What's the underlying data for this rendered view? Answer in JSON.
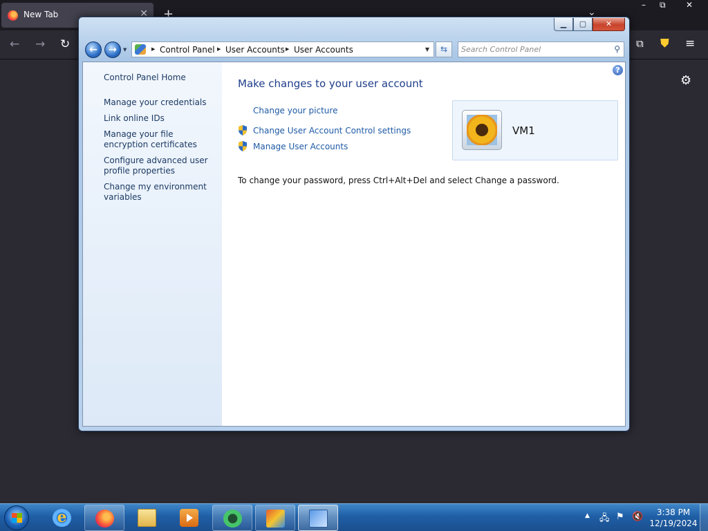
{
  "browser": {
    "tab_title": "New Tab",
    "tab_close": "✕",
    "new_tab": "+",
    "list_all_tabs": "⌄"
  },
  "window": {
    "minimize": "▁",
    "maximize": "▢",
    "close": "✕"
  },
  "address": {
    "crumbs": [
      "Control Panel",
      "User Accounts",
      "User Accounts"
    ]
  },
  "search": {
    "placeholder": "Search Control Panel"
  },
  "sidebar": {
    "items": [
      {
        "label": "Control Panel Home"
      },
      {
        "label": "Manage your credentials"
      },
      {
        "label": "Link online IDs"
      },
      {
        "label": "Manage your file encryption certificates"
      },
      {
        "label": "Configure advanced user profile properties"
      },
      {
        "label": "Change my environment variables"
      }
    ]
  },
  "main": {
    "heading": "Make changes to your user account",
    "tasks": [
      {
        "label": "Change your picture"
      },
      {
        "label": "Change User Account Control settings"
      },
      {
        "label": "Manage User Accounts"
      }
    ],
    "password_note": "To change your password, press Ctrl+Alt+Del and select Change a password.",
    "help": "?"
  },
  "user": {
    "name": "VM1"
  },
  "clock": {
    "time": "3:38 PM",
    "date": "12/19/2024"
  },
  "colors": {
    "link": "#1e5aa5",
    "heading": "#1e3d8a",
    "taskbar": "#1f5fa6"
  }
}
